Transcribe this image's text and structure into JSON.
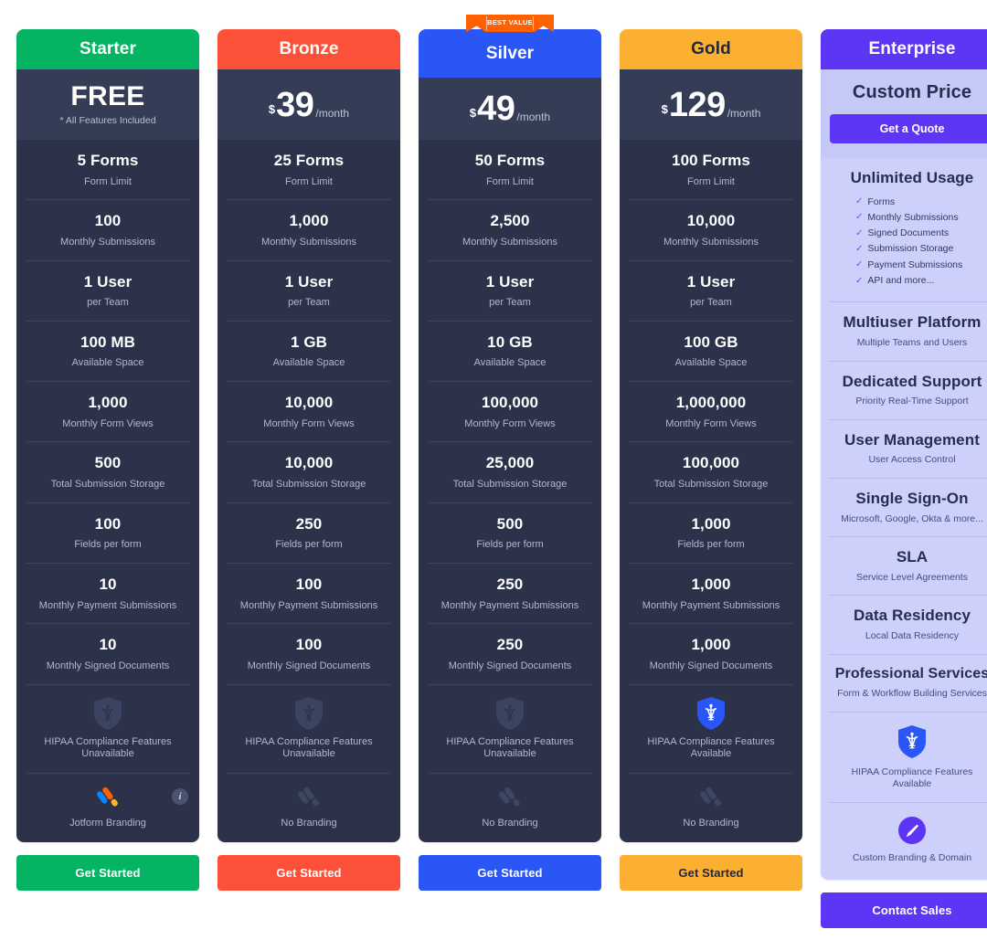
{
  "colors": {
    "starter": "#04b462",
    "bronze": "#fc5138",
    "silver": "#2a56f5",
    "gold": "#fcb031",
    "enterprise": "#5c36f4",
    "dark_body": "#2b3249",
    "price_bg": "#343c56",
    "badge": "#ff6100"
  },
  "badge": {
    "label": "BEST VALUE"
  },
  "plans": [
    {
      "name": "Starter",
      "header_color": "#04b462",
      "header_text_color": "#ffffff",
      "price": {
        "currency": "",
        "amount": "FREE",
        "per": "",
        "note": "* All Features Included"
      },
      "features": [
        {
          "value": "5 Forms",
          "label": "Form Limit"
        },
        {
          "value": "100",
          "label": "Monthly Submissions"
        },
        {
          "value": "1 User",
          "label": "per Team"
        },
        {
          "value": "100 MB",
          "label": "Available Space"
        },
        {
          "value": "1,000",
          "label": "Monthly Form Views"
        },
        {
          "value": "500",
          "label": "Total Submission Storage"
        },
        {
          "value": "100",
          "label": "Fields per form"
        },
        {
          "value": "10",
          "label": "Monthly Payment Submissions"
        },
        {
          "value": "10",
          "label": "Monthly Signed Documents"
        }
      ],
      "hipaa": {
        "icon": "hipaa-shield-icon",
        "available": false,
        "label": "HIPAA Compliance Features Unavailable"
      },
      "branding": {
        "icon": "jotform-logo-icon",
        "colored": true,
        "label": "Jotform Branding",
        "info_icon": "info-icon",
        "info_label": "i"
      },
      "cta": {
        "label": "Get Started",
        "bg": "#04b462",
        "color": "#ffffff"
      }
    },
    {
      "name": "Bronze",
      "header_color": "#fc5138",
      "header_text_color": "#ffffff",
      "price": {
        "currency": "$",
        "amount": "39",
        "per": "/month",
        "note": ""
      },
      "features": [
        {
          "value": "25 Forms",
          "label": "Form Limit"
        },
        {
          "value": "1,000",
          "label": "Monthly Submissions"
        },
        {
          "value": "1 User",
          "label": "per Team"
        },
        {
          "value": "1 GB",
          "label": "Available Space"
        },
        {
          "value": "10,000",
          "label": "Monthly Form Views"
        },
        {
          "value": "10,000",
          "label": "Total Submission Storage"
        },
        {
          "value": "250",
          "label": "Fields per form"
        },
        {
          "value": "100",
          "label": "Monthly Payment Submissions"
        },
        {
          "value": "100",
          "label": "Monthly Signed Documents"
        }
      ],
      "hipaa": {
        "icon": "hipaa-shield-icon",
        "available": false,
        "label": "HIPAA Compliance Features Unavailable"
      },
      "branding": {
        "icon": "jotform-logo-icon",
        "colored": false,
        "label": "No Branding",
        "info_icon": "",
        "info_label": ""
      },
      "cta": {
        "label": "Get Started",
        "bg": "#fc5138",
        "color": "#ffffff"
      }
    },
    {
      "name": "Silver",
      "header_color": "#2a56f5",
      "header_text_color": "#ffffff",
      "price": {
        "currency": "$",
        "amount": "49",
        "per": "/month",
        "note": ""
      },
      "features": [
        {
          "value": "50 Forms",
          "label": "Form Limit"
        },
        {
          "value": "2,500",
          "label": "Monthly Submissions"
        },
        {
          "value": "1 User",
          "label": "per Team"
        },
        {
          "value": "10 GB",
          "label": "Available Space"
        },
        {
          "value": "100,000",
          "label": "Monthly Form Views"
        },
        {
          "value": "25,000",
          "label": "Total Submission Storage"
        },
        {
          "value": "500",
          "label": "Fields per form"
        },
        {
          "value": "250",
          "label": "Monthly Payment Submissions"
        },
        {
          "value": "250",
          "label": "Monthly Signed Documents"
        }
      ],
      "hipaa": {
        "icon": "hipaa-shield-icon",
        "available": false,
        "label": "HIPAA Compliance Features Unavailable"
      },
      "branding": {
        "icon": "jotform-logo-icon",
        "colored": false,
        "label": "No Branding",
        "info_icon": "",
        "info_label": ""
      },
      "cta": {
        "label": "Get Started",
        "bg": "#2a56f5",
        "color": "#ffffff"
      }
    },
    {
      "name": "Gold",
      "header_color": "#fcb031",
      "header_text_color": "#21283d",
      "price": {
        "currency": "$",
        "amount": "129",
        "per": "/month",
        "note": ""
      },
      "features": [
        {
          "value": "100 Forms",
          "label": "Form Limit"
        },
        {
          "value": "10,000",
          "label": "Monthly Submissions"
        },
        {
          "value": "1 User",
          "label": "per Team"
        },
        {
          "value": "100 GB",
          "label": "Available Space"
        },
        {
          "value": "1,000,000",
          "label": "Monthly Form Views"
        },
        {
          "value": "100,000",
          "label": "Total Submission Storage"
        },
        {
          "value": "1,000",
          "label": "Fields per form"
        },
        {
          "value": "1,000",
          "label": "Monthly Payment Submissions"
        },
        {
          "value": "1,000",
          "label": "Monthly Signed Documents"
        }
      ],
      "hipaa": {
        "icon": "hipaa-shield-icon",
        "available": true,
        "label": "HIPAA Compliance Features Available"
      },
      "branding": {
        "icon": "jotform-logo-icon",
        "colored": false,
        "label": "No Branding",
        "info_icon": "",
        "info_label": ""
      },
      "cta": {
        "label": "Get Started",
        "bg": "#fcb031",
        "color": "#21283d"
      }
    }
  ],
  "enterprise": {
    "name": "Enterprise",
    "header_color": "#5c36f4",
    "header_text_color": "#ffffff",
    "price_title": "Custom Price",
    "quote_button": "Get a Quote",
    "rows": [
      {
        "value": "Unlimited Usage",
        "label": "",
        "list": [
          "Forms",
          "Monthly Submissions",
          "Signed Documents",
          "Submission Storage",
          "Payment Submissions",
          "API and more..."
        ]
      },
      {
        "value": "Multiuser Platform",
        "label": "Multiple Teams and Users",
        "list": []
      },
      {
        "value": "Dedicated Support",
        "label": "Priority Real-Time Support",
        "list": []
      },
      {
        "value": "User Management",
        "label": "User Access Control",
        "list": []
      },
      {
        "value": "Single Sign-On",
        "label": "Microsoft, Google, Okta & more...",
        "list": []
      },
      {
        "value": "SLA",
        "label": "Service Level Agreements",
        "list": []
      },
      {
        "value": "Data Residency",
        "label": "Local Data Residency",
        "list": []
      },
      {
        "value": "Professional Services",
        "label": "Form & Workflow Building Services",
        "list": []
      }
    ],
    "hipaa": {
      "icon": "hipaa-shield-icon",
      "available": true,
      "label": "HIPAA Compliance Features Available"
    },
    "branding": {
      "icon": "custom-branding-icon",
      "label": "Custom Branding & Domain"
    },
    "cta": {
      "label": "Contact Sales",
      "bg": "#5c36f4",
      "color": "#ffffff"
    }
  }
}
